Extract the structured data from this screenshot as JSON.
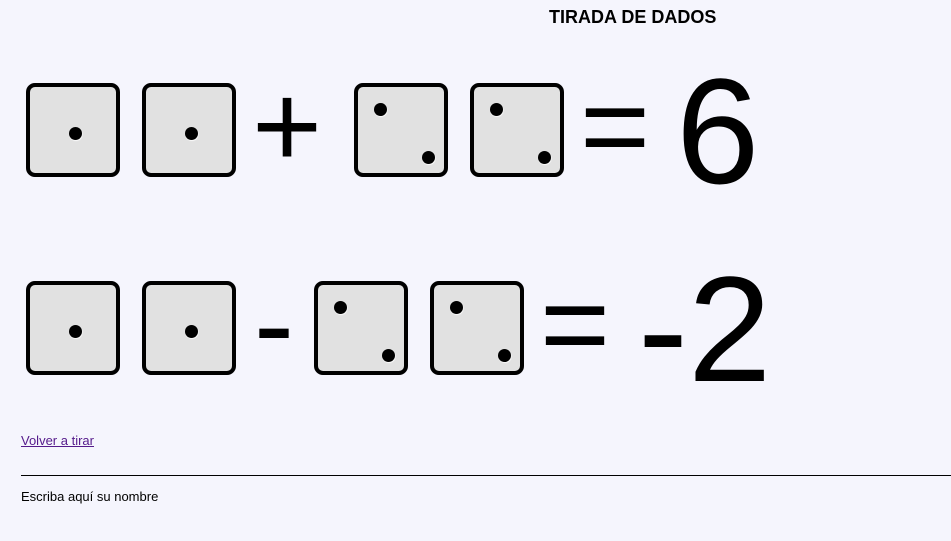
{
  "page": {
    "title": "TIRADA DE DADOS"
  },
  "equations": [
    {
      "dice": [
        1,
        1,
        2,
        2
      ],
      "operator": "+",
      "equals": "=",
      "result": "6"
    },
    {
      "dice": [
        1,
        1,
        2,
        2
      ],
      "operator": "-",
      "equals": "=",
      "result": "-2"
    }
  ],
  "actions": {
    "reroll_link": "Volver a tirar"
  },
  "form": {
    "name_label": "Escriba aquí su nombre"
  },
  "colors": {
    "background": "#f5f5fd",
    "die_face": "#e1e1e1",
    "link": "#551a8b"
  }
}
